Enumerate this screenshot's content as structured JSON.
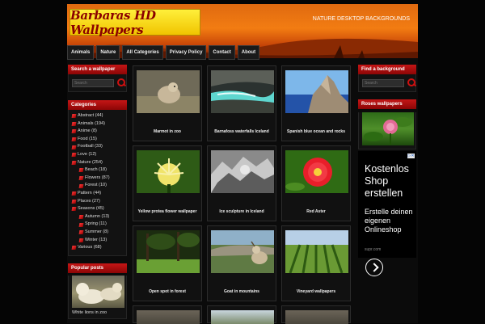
{
  "header": {
    "logo_text": "Barbaras HD Wallpapers",
    "tagline": "NATURE DESKTOP BACKGROUNDS"
  },
  "nav": [
    "Animals",
    "Nature",
    "All Categories",
    "Privacy Policy",
    "Contact",
    "About"
  ],
  "left_sidebar": {
    "search_title": "Search a wallpaper",
    "search_placeholder": "Search",
    "categories_title": "Categories",
    "categories": [
      {
        "label": "Abstract (44)",
        "sub": false
      },
      {
        "label": "Animals (194)",
        "sub": false
      },
      {
        "label": "Anime (8)",
        "sub": false
      },
      {
        "label": "Food (15)",
        "sub": false
      },
      {
        "label": "Football (33)",
        "sub": false
      },
      {
        "label": "Love (12)",
        "sub": false
      },
      {
        "label": "Nature (254)",
        "sub": false
      },
      {
        "label": "Beach (18)",
        "sub": true
      },
      {
        "label": "Flowers (87)",
        "sub": true
      },
      {
        "label": "Forest (10)",
        "sub": true
      },
      {
        "label": "Pattern (44)",
        "sub": false
      },
      {
        "label": "Places (27)",
        "sub": false
      },
      {
        "label": "Seasons (45)",
        "sub": false
      },
      {
        "label": "Autumn (13)",
        "sub": true
      },
      {
        "label": "Spring (11)",
        "sub": true
      },
      {
        "label": "Summer (8)",
        "sub": true
      },
      {
        "label": "Winter (13)",
        "sub": true
      },
      {
        "label": "Various (68)",
        "sub": false
      }
    ],
    "popular_title": "Popular posts",
    "popular_caption": "White lions in zoo"
  },
  "posts": [
    {
      "title": "Marmot in zoo",
      "thumb": "marmot"
    },
    {
      "title": "Barnafoss waterfalls Iceland",
      "thumb": "waterfall"
    },
    {
      "title": "Spanish blue ocean and rocks",
      "thumb": "ocean"
    },
    {
      "title": "Yellow protea flower wallpaper",
      "thumb": "protea"
    },
    {
      "title": "Ice sculpture in Iceland",
      "thumb": "ice"
    },
    {
      "title": "Red Aster",
      "thumb": "aster"
    },
    {
      "title": "Open spot in forest",
      "thumb": "forest"
    },
    {
      "title": "Goat in mountains",
      "thumb": "goat"
    },
    {
      "title": "Vineyard wallpapers",
      "thumb": "vineyard"
    }
  ],
  "right_sidebar": {
    "find_title": "Find a background",
    "search_placeholder": "Search",
    "roses_title": "Roses wallpapers"
  },
  "ad": {
    "title": "Kostenlos Shop erstellen",
    "text": "Erstelle deinen eigenen Onlineshop",
    "url": "supr.com"
  }
}
